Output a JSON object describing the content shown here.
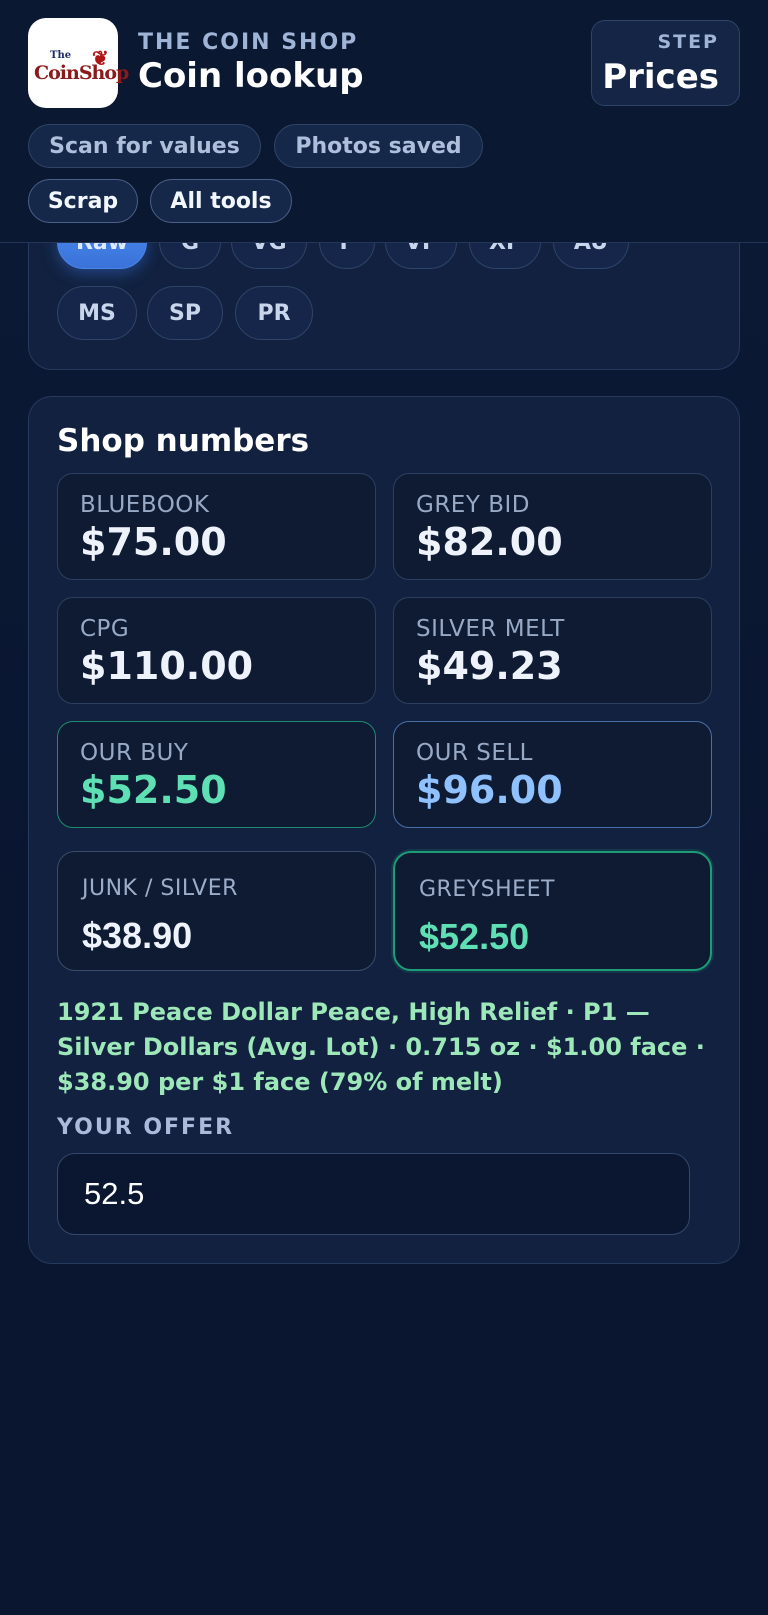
{
  "header": {
    "logo_alt": "The Coin Shop",
    "brand_kicker": "THE COIN SHOP",
    "brand_title": "Coin lookup",
    "step_label": "STEP",
    "step_value": "Prices",
    "nav": [
      "Scan for values",
      "Photos saved",
      "Scrap",
      "All tools"
    ]
  },
  "grades": {
    "row1": [
      "Raw",
      "G",
      "VG",
      "F",
      "VF",
      "XF",
      "AU"
    ],
    "row2": [
      "MS",
      "SP",
      "PR"
    ],
    "selected": "Raw"
  },
  "shop_numbers": {
    "title": "Shop numbers",
    "tiles": [
      {
        "label": "BLUEBOOK",
        "value": "$75.00"
      },
      {
        "label": "GREY BID",
        "value": "$82.00"
      },
      {
        "label": "CPG",
        "value": "$110.00"
      },
      {
        "label": "SILVER MELT",
        "value": "$49.23"
      },
      {
        "label": "OUR BUY",
        "value": "$52.50"
      },
      {
        "label": "OUR SELL",
        "value": "$96.00"
      }
    ],
    "junk_silver": {
      "label": "JUNK / SILVER",
      "value": "$38.90"
    },
    "greysheet": {
      "label": "GREYSHEET",
      "value": "$52.50"
    },
    "detail": "1921 Peace Dollar Peace, High Relief · P1 — Silver Dollars (Avg. Lot) · 0.715 oz · $1.00 face · $38.90 per $1 face (79% of melt)",
    "offer_label": "YOUR OFFER",
    "offer_value": "52.5"
  },
  "colors": {
    "background": "#0a1630",
    "card": "#11213f",
    "accent_green": "#5fe0b4",
    "accent_blue": "#8fc1ff",
    "active_chip": "#4a8cf0",
    "detail_text": "#9de7b9"
  }
}
